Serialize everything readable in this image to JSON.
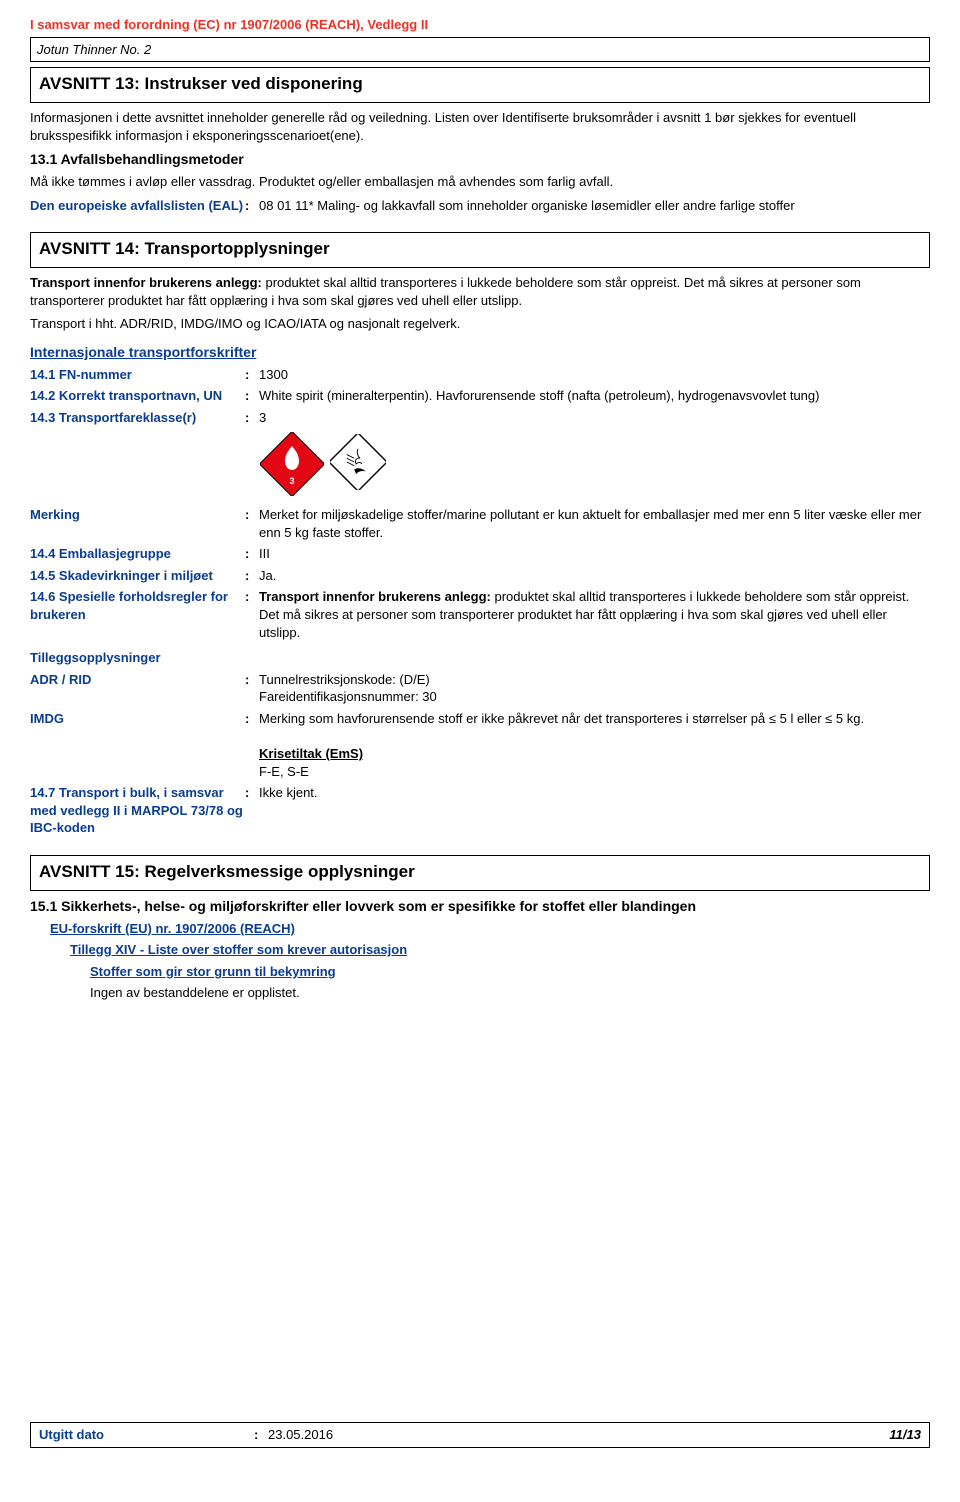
{
  "header": {
    "reach_line": "I samsvar med forordning (EC) nr 1907/2006 (REACH), Vedlegg II",
    "product": "Jotun Thinner No. 2"
  },
  "section13": {
    "title": "AVSNITT 13: Instrukser ved disponering",
    "intro": "Informasjonen i dette avsnittet inneholder generelle råd og veiledning. Listen over Identifiserte bruksområder i avsnitt 1 bør sjekkes for eventuell bruksspesifikk informasjon i eksponeringsscenarioet(ene).",
    "sub": "13.1 Avfallsbehandlingsmetoder",
    "line": "Må ikke tømmes i avløp eller vassdrag. Produktet og/eller emballasjen må avhendes som farlig avfall.",
    "eal_label": "Den europeiske avfallslisten (EAL)",
    "eal_value": "08 01 11* Maling- og lakkavfall som inneholder organiske løsemidler eller andre farlige stoffer"
  },
  "section14": {
    "title": "AVSNITT 14: Transportopplysninger",
    "para1_bold": "Transport innenfor brukerens anlegg:",
    "para1_rest": " produktet skal alltid transporteres i lukkede beholdere som står oppreist. Det må sikres at personer som transporterer produktet har fått opplæring i hva som skal gjøres ved uhell eller utslipp.",
    "para2": "Transport i hht. ADR/RID, IMDG/IMO og ICAO/IATA og nasjonalt regelverk.",
    "intl_heading": "Internasjonale transportforskrifter",
    "fn_label": "14.1 FN-nummer",
    "fn_value": "1300",
    "navn_label": "14.2 Korrekt transportnavn, UN",
    "navn_value": "White spirit (mineralterpentin). Havforurensende stoff (nafta (petroleum), hydrogenavsvovlet tung)",
    "klasse_label": "14.3 Transportfareklasse(r)",
    "klasse_value": "3",
    "merking_label": "Merking",
    "merking_value": "Merket for miljøskadelige stoffer/marine pollutant er kun aktuelt for emballasjer med mer enn 5 liter væske eller mer enn 5 kg faste stoffer.",
    "emb_label": "14.4 Emballasjegruppe",
    "emb_value": "III",
    "skade_label": "14.5 Skadevirkninger i miljøet",
    "skade_value": "Ja.",
    "spes_label": "14.6 Spesielle forholdsregler for brukeren",
    "spes_value_bold": "Transport innenfor brukerens anlegg:",
    "spes_value_rest": " produktet skal alltid transporteres i lukkede beholdere som står oppreist. Det må sikres at personer som transporterer produktet har fått opplæring i hva som skal gjøres ved uhell eller utslipp.",
    "tillegg": "Tilleggsopplysninger",
    "adr_label": "ADR / RID",
    "adr_value1": "Tunnelrestriksjonskode: (D/E)",
    "adr_value2": "Fareidentifikasjonsnummer: 30",
    "imdg_label": "IMDG",
    "imdg_value": "Merking som havforurensende stoff er ikke påkrevet når det transporteres i størrelser på ≤ 5 l eller ≤ 5 kg.",
    "ems_head": "Krisetiltak (EmS)",
    "ems_value": "F-E, S-E",
    "bulk_label": "14.7 Transport i bulk, i samsvar med vedlegg II i MARPOL 73/78 og IBC-koden",
    "bulk_value": "Ikke kjent."
  },
  "section15": {
    "title": "AVSNITT 15: Regelverksmessige opplysninger",
    "sub": "15.1 Sikkerhets-, helse- og miljøforskrifter eller lovverk som er spesifikke for stoffet eller blandingen",
    "eu": "EU-forskrift (EU) nr. 1907/2006 (REACH)",
    "tillegg14": "Tillegg XIV - Liste over stoffer som krever autorisasjon",
    "concern": "Stoffer som gir stor grunn til bekymring",
    "none": "Ingen av bestanddelene er opplistet."
  },
  "footer": {
    "label": "Utgitt dato",
    "date": "23.05.2016",
    "page": "11/13"
  }
}
